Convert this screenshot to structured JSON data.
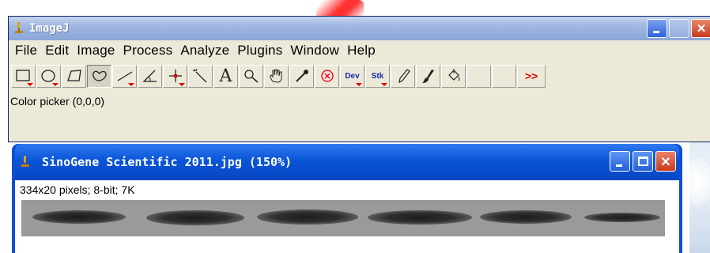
{
  "main_window": {
    "title": "ImageJ",
    "menu": [
      "File",
      "Edit",
      "Image",
      "Process",
      "Analyze",
      "Plugins",
      "Window",
      "Help"
    ],
    "tools": [
      {
        "name": "rectangle-tool",
        "icon": "rectangle-selection-icon"
      },
      {
        "name": "oval-tool",
        "icon": "oval-selection-icon"
      },
      {
        "name": "polygon-tool",
        "icon": "polygon-selection-icon"
      },
      {
        "name": "freehand-tool",
        "icon": "freehand-selection-icon",
        "active": true
      },
      {
        "name": "line-tool",
        "icon": "straight-line-icon"
      },
      {
        "name": "angle-tool",
        "icon": "angle-icon"
      },
      {
        "name": "point-tool",
        "icon": "crosshair-point-icon"
      },
      {
        "name": "wand-tool",
        "icon": "magic-wand-icon"
      },
      {
        "name": "text-tool",
        "icon": "text-icon",
        "label": "A"
      },
      {
        "name": "magnifier-tool",
        "icon": "magnifier-icon"
      },
      {
        "name": "scroll-tool",
        "icon": "hand-scroll-icon"
      },
      {
        "name": "color-picker-tool",
        "icon": "eyedropper-icon"
      },
      {
        "name": "macro-tool",
        "icon": "circle-x-icon"
      },
      {
        "name": "dev-tool",
        "icon": "dev-menu-icon",
        "label": "Dev"
      },
      {
        "name": "stk-tool",
        "icon": "stack-menu-icon",
        "label": "Stk"
      },
      {
        "name": "pencil-tool",
        "icon": "pencil-icon"
      },
      {
        "name": "brush-tool",
        "icon": "paintbrush-icon"
      },
      {
        "name": "flood-fill-tool",
        "icon": "paint-bucket-icon"
      },
      {
        "name": "empty-slot-1",
        "icon": ""
      },
      {
        "name": "empty-slot-2",
        "icon": ""
      },
      {
        "name": "more-tools",
        "icon": "more-tools-icon",
        "label": ">>"
      }
    ],
    "status": "Color picker (0,0,0)"
  },
  "image_window": {
    "title": "SinoGene Scientific 2011.jpg (150%)",
    "info": "334x20 pixels; 8-bit; 7K",
    "bands": 6
  },
  "colors": {
    "xp_blue_titlebar": "#0a55d8",
    "inactive_titlebar": "#9fb6e0",
    "window_face": "#ece9d8",
    "close_button": "#c93a1c",
    "dropdown_marker": "#e00000"
  }
}
